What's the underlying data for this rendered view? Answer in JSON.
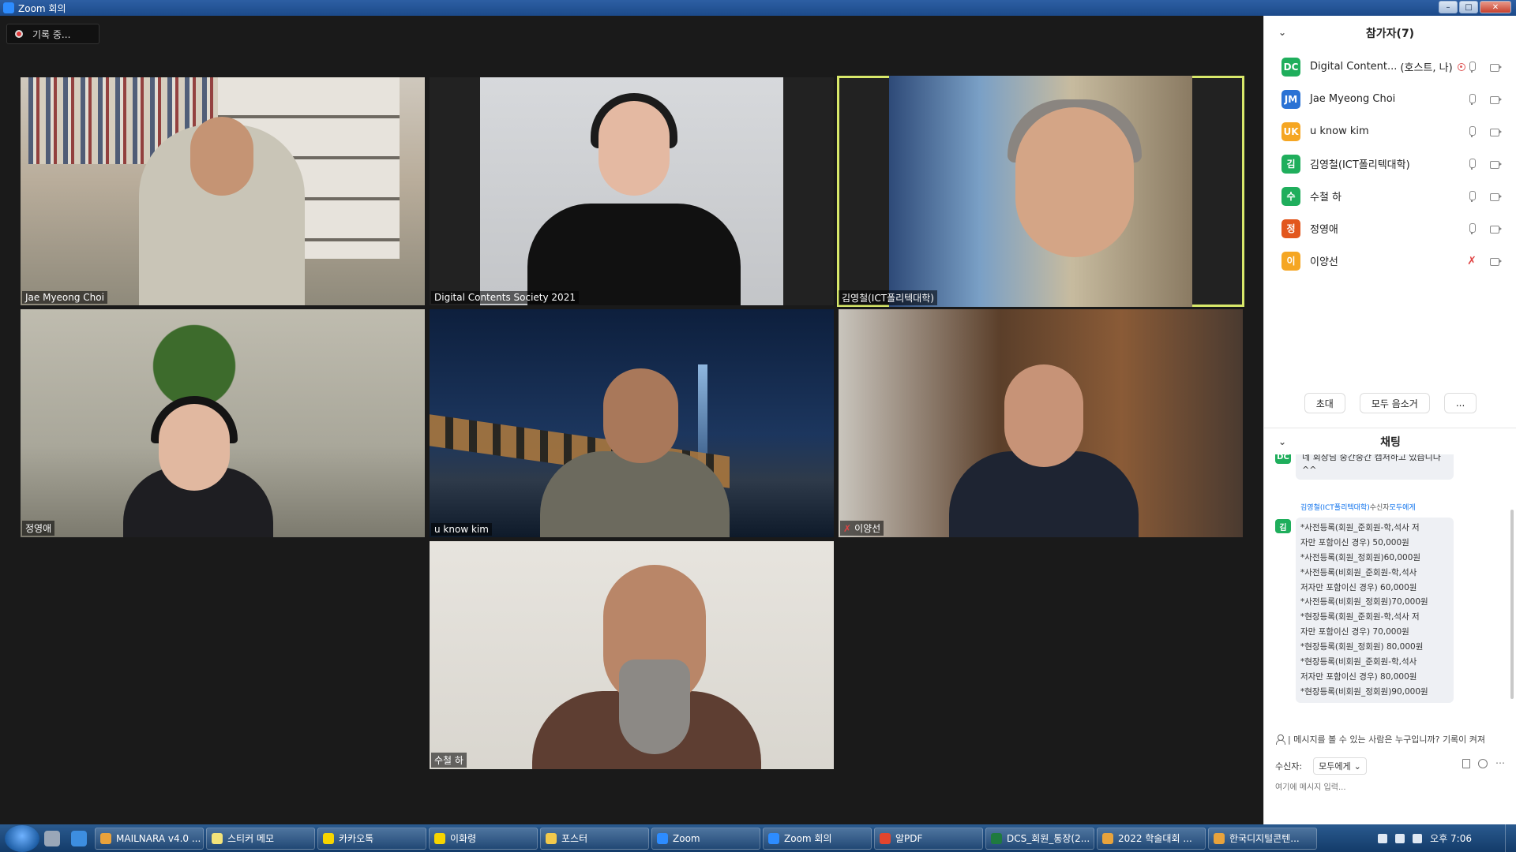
{
  "window": {
    "title": "Zoom 회의",
    "minimize": "–",
    "maximize": "□",
    "close": "✕"
  },
  "recording": {
    "label": "기록 중..."
  },
  "tiles": [
    {
      "name": "Jae Myeong Choi"
    },
    {
      "name": "Digital Contents Society 2021"
    },
    {
      "name": "김영철(ICT폴리텍대학)"
    },
    {
      "name": "정영애"
    },
    {
      "name": "u know kim"
    },
    {
      "name": "이양선"
    },
    {
      "name": "수철 하"
    }
  ],
  "participants": {
    "title": "참가자(7)",
    "collapse": "⌄",
    "items": [
      {
        "initials": "DC",
        "color": "#1fae5c",
        "name": "Digital Content...",
        "extra": "(호스트, 나)"
      },
      {
        "initials": "JM",
        "color": "#2a72d4",
        "name": "Jae Myeong Choi",
        "extra": ""
      },
      {
        "initials": "UK",
        "color": "#f5a623",
        "name": "u know kim",
        "extra": ""
      },
      {
        "initials": "김",
        "color": "#1fae5c",
        "name": "김영철(ICT폴리텍대학)",
        "extra": ""
      },
      {
        "initials": "수",
        "color": "#1fae5c",
        "name": "수철 하",
        "extra": ""
      },
      {
        "initials": "정",
        "color": "#e2571e",
        "name": "정영애",
        "extra": ""
      },
      {
        "initials": "이",
        "color": "#f5a623",
        "name": "이양선",
        "extra": ""
      }
    ],
    "buttons": {
      "invite": "초대",
      "mute_all": "모두 음소거",
      "more": "..."
    }
  },
  "chat": {
    "title": "채팅",
    "collapse": "⌄",
    "prev_sender_initials": "DC",
    "prev_message": "네 회장님 중간중간 캡처하고 있습니다^^",
    "sender": "김영철(ICT폴리텍대학)",
    "to_label": "수신자",
    "to_target": "모두에게",
    "sender_initials": "김",
    "message_lines": [
      "*사전등록(회원_준회원-학,석사 저",
      "자만 포함이신 경우) 50,000원",
      "*사전등록(회원_정회원)60,000원",
      "*사전등록(비회원_준회원-학,석사",
      "저자만 포함이신 경우) 60,000원",
      "*사전등록(비회원_정회원)70,000원",
      "*현장등록(회원_준회원-학,석사 저",
      "자만 포함이신 경우) 70,000원",
      "*현장등록(회원_정회원) 80,000원",
      "*현장등록(비회원_준회원-학,석사",
      "저자만 포함이신 경우) 80,000원",
      "*현장등록(비회원_정회원)90,000원"
    ],
    "notice": "| 메시지를 볼 수 있는 사람은 누구입니까? 기록이 켜져",
    "recipient_label": "수신자:",
    "recipient_value": "모두에게",
    "input_placeholder": "여기에 메시지 입력..."
  },
  "taskbar": {
    "tasks": [
      {
        "label": "MAILNARA v4.0 ...",
        "color": "#e9a23b"
      },
      {
        "label": "스티커 메모",
        "color": "#f3e37a"
      },
      {
        "label": "카카오톡",
        "color": "#f7d500"
      },
      {
        "label": "이화령",
        "color": "#f7d500"
      },
      {
        "label": "포스터",
        "color": "#f2c94c"
      },
      {
        "label": "Zoom",
        "color": "#2d8cff"
      },
      {
        "label": "Zoom 회의",
        "color": "#2d8cff"
      },
      {
        "label": "알PDF",
        "color": "#e2452e"
      },
      {
        "label": "DCS_회원_통장(2...",
        "color": "#1f7a3f"
      },
      {
        "label": "2022 학술대회 ...",
        "color": "#e8a33c"
      },
      {
        "label": "한국디지털콘텐...",
        "color": "#e8a33c"
      }
    ],
    "clock": "오후 7:06"
  }
}
